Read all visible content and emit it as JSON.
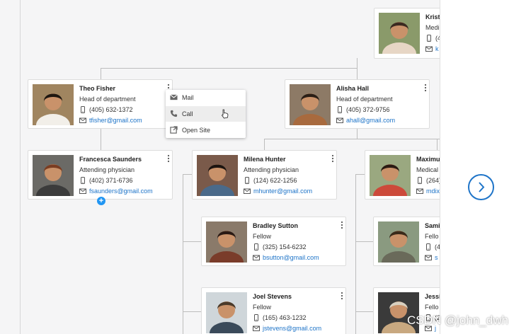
{
  "cards": [
    {
      "key": "kristen",
      "name": "Krist",
      "role": "Medi",
      "phone": "(4",
      "email": "k",
      "colors": [
        "#8a9a6a",
        "#e7d6c5",
        "#3b2a20"
      ]
    },
    {
      "key": "theo",
      "name": "Theo Fisher",
      "role": "Head of department",
      "phone": "(405) 632-1372",
      "email": "tfisher@gmail.com",
      "colors": [
        "#a08560",
        "#f2efe9",
        "#1e1710"
      ]
    },
    {
      "key": "alisha",
      "name": "Alisha Hall",
      "role": "Head of department",
      "phone": "(405) 372-9756",
      "email": "ahall@gmail.com",
      "colors": [
        "#8d7a66",
        "#a86a3e",
        "#2a1e16"
      ]
    },
    {
      "key": "francesca",
      "name": "Francesca Saunders",
      "role": "Attending physician",
      "phone": "(402) 371-6736",
      "email": "fsaunders@gmail.com",
      "colors": [
        "#6b6a66",
        "#3b3b3b",
        "#7a3d22"
      ]
    },
    {
      "key": "milena",
      "name": "Milena Hunter",
      "role": "Attending physician",
      "phone": "(124) 622-1256",
      "email": "mhunter@gmail.com",
      "colors": [
        "#7a5a4a",
        "#4a6a8a",
        "#1c1410"
      ]
    },
    {
      "key": "maximus",
      "name": "Maximu",
      "role": "Medical",
      "phone": "(264)",
      "email": "mdix",
      "colors": [
        "#9aa880",
        "#cc4a3a",
        "#2a1a12"
      ]
    },
    {
      "key": "bradley",
      "name": "Bradley Sutton",
      "role": "Fellow",
      "phone": "(325) 154-6232",
      "email": "bsutton@gmail.com",
      "colors": [
        "#8a7a6a",
        "#7a3c2a",
        "#2a1a14"
      ]
    },
    {
      "key": "sami",
      "name": "Sami",
      "role": "Fello",
      "phone": "(4",
      "email": "s",
      "colors": [
        "#8a9a80",
        "#6a6a5a",
        "#3a2a1a"
      ]
    },
    {
      "key": "joel",
      "name": "Joel Stevens",
      "role": "Fellow",
      "phone": "(165) 463-1232",
      "email": "jstevens@gmail.com",
      "colors": [
        "#cfd6da",
        "#3a4a5a",
        "#4a3a2a"
      ]
    },
    {
      "key": "jessi",
      "name": "Jessi",
      "role": "Fello",
      "phone": "(2",
      "email": "j",
      "colors": [
        "#3a3a3a",
        "#c8a880",
        "#d8d0c0"
      ]
    }
  ],
  "context_menu": {
    "items": [
      {
        "label": "Mail",
        "icon": "mail-icon"
      },
      {
        "label": "Call",
        "icon": "phone-icon"
      },
      {
        "label": "Open Site",
        "icon": "external-link-icon"
      }
    ]
  },
  "add_button": {
    "label": "+"
  },
  "next_button": {
    "icon": "chevron-right-icon"
  },
  "watermark": "CSDN @john_dwh"
}
